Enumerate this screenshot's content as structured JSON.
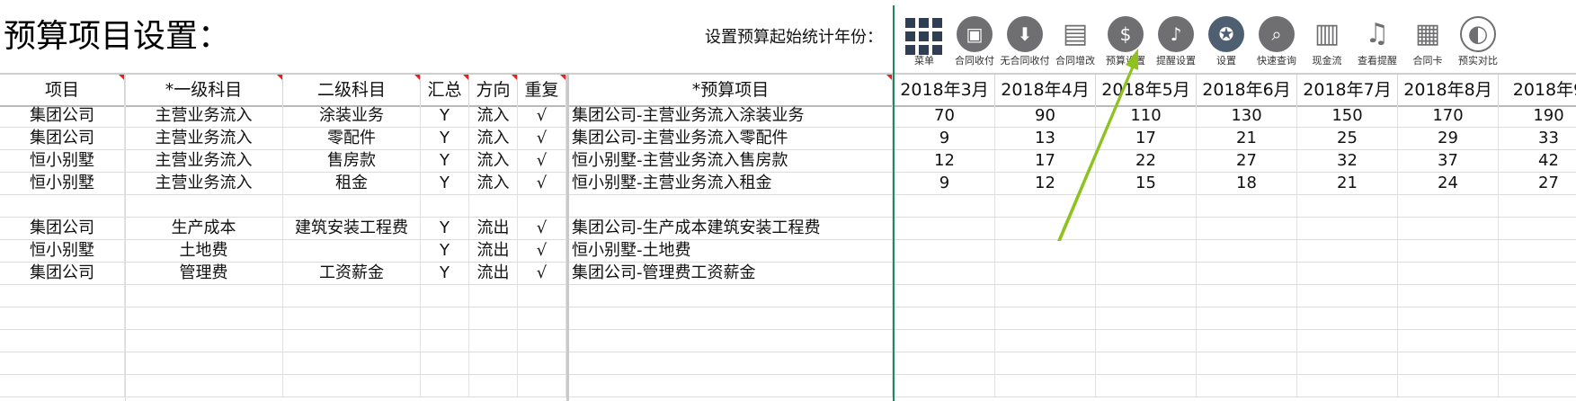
{
  "page_title": "预算项目设置：",
  "start_year_label": "设置预算起始统计年份：",
  "toolbar": [
    {
      "label": "菜单",
      "icon": "grid-icon"
    },
    {
      "label": "合同收付",
      "icon": "wallet-icon"
    },
    {
      "label": "无合同收付",
      "icon": "download-icon"
    },
    {
      "label": "合同增改",
      "icon": "document-icon"
    },
    {
      "label": "预算设置",
      "icon": "money-bag-icon"
    },
    {
      "label": "提醒设置",
      "icon": "speaker-icon"
    },
    {
      "label": "设置",
      "icon": "gear-icon"
    },
    {
      "label": "快速查询",
      "icon": "search-icon"
    },
    {
      "label": "现金流",
      "icon": "chart-icon"
    },
    {
      "label": "查看提醒",
      "icon": "bell-icon"
    },
    {
      "label": "合同卡",
      "icon": "card-icon"
    },
    {
      "label": "预实对比",
      "icon": "contrast-icon"
    }
  ],
  "columns": [
    "项目",
    "*一级科目",
    "二级科目",
    "汇总",
    "方向",
    "重复",
    "*预算项目"
  ],
  "months": [
    "2018年3月",
    "2018年4月",
    "2018年5月",
    "2018年6月",
    "2018年7月",
    "2018年8月",
    "2018年9"
  ],
  "rows": [
    {
      "project": "集团公司",
      "level1": "主营业务流入",
      "level2": "涂装业务",
      "summary": "Y",
      "direction": "流入",
      "repeat": "√",
      "budget_item": "集团公司-主营业务流入涂装业务",
      "values": [
        "70",
        "90",
        "110",
        "130",
        "150",
        "170",
        "190"
      ]
    },
    {
      "project": "集团公司",
      "level1": "主营业务流入",
      "level2": "零配件",
      "summary": "Y",
      "direction": "流入",
      "repeat": "√",
      "budget_item": "集团公司-主营业务流入零配件",
      "values": [
        "9",
        "13",
        "17",
        "21",
        "25",
        "29",
        "33"
      ]
    },
    {
      "project": "恒小别墅",
      "level1": "主营业务流入",
      "level2": "售房款",
      "summary": "Y",
      "direction": "流入",
      "repeat": "√",
      "budget_item": "恒小别墅-主营业务流入售房款",
      "values": [
        "12",
        "17",
        "22",
        "27",
        "32",
        "37",
        "42"
      ]
    },
    {
      "project": "恒小别墅",
      "level1": "主营业务流入",
      "level2": "租金",
      "summary": "Y",
      "direction": "流入",
      "repeat": "√",
      "budget_item": "恒小别墅-主营业务流入租金",
      "values": [
        "9",
        "12",
        "15",
        "18",
        "21",
        "24",
        "27"
      ]
    },
    {
      "project": "",
      "level1": "",
      "level2": "",
      "summary": "",
      "direction": "",
      "repeat": "",
      "budget_item": "",
      "values": [
        "",
        "",
        "",
        "",
        "",
        "",
        ""
      ]
    },
    {
      "project": "集团公司",
      "level1": "生产成本",
      "level2": "建筑安装工程费",
      "summary": "Y",
      "direction": "流出",
      "repeat": "√",
      "budget_item": "集团公司-生产成本建筑安装工程费",
      "values": [
        "",
        "",
        "",
        "",
        "",
        "",
        ""
      ]
    },
    {
      "project": "恒小别墅",
      "level1": "土地费",
      "level2": "",
      "summary": "Y",
      "direction": "流出",
      "repeat": "√",
      "budget_item": "恒小别墅-土地费",
      "values": [
        "",
        "",
        "",
        "",
        "",
        "",
        ""
      ]
    },
    {
      "project": "集团公司",
      "level1": "管理费",
      "level2": "工资薪金",
      "summary": "Y",
      "direction": "流出",
      "repeat": "√",
      "budget_item": "集团公司-管理费工资薪金",
      "values": [
        "",
        "",
        "",
        "",
        "",
        "",
        ""
      ]
    },
    {
      "project": "",
      "level1": "",
      "level2": "",
      "summary": "",
      "direction": "",
      "repeat": "",
      "budget_item": "",
      "values": [
        "",
        "",
        "",
        "",
        "",
        "",
        ""
      ]
    },
    {
      "project": "",
      "level1": "",
      "level2": "",
      "summary": "",
      "direction": "",
      "repeat": "",
      "budget_item": "",
      "values": [
        "",
        "",
        "",
        "",
        "",
        "",
        ""
      ]
    },
    {
      "project": "",
      "level1": "",
      "level2": "",
      "summary": "",
      "direction": "",
      "repeat": "",
      "budget_item": "",
      "values": [
        "",
        "",
        "",
        "",
        "",
        "",
        ""
      ]
    },
    {
      "project": "",
      "level1": "",
      "level2": "",
      "summary": "",
      "direction": "",
      "repeat": "",
      "budget_item": "",
      "values": [
        "",
        "",
        "",
        "",
        "",
        "",
        ""
      ]
    },
    {
      "project": "",
      "level1": "",
      "level2": "",
      "summary": "",
      "direction": "",
      "repeat": "",
      "budget_item": "",
      "values": [
        "",
        "",
        "",
        "",
        "",
        "",
        ""
      ]
    }
  ],
  "colors": {
    "freeze_line": "#1a8c5c",
    "annotation_arrow": "#8dc21f",
    "comment_marker": "#e52020",
    "icon_gray": "#6f6f72"
  }
}
